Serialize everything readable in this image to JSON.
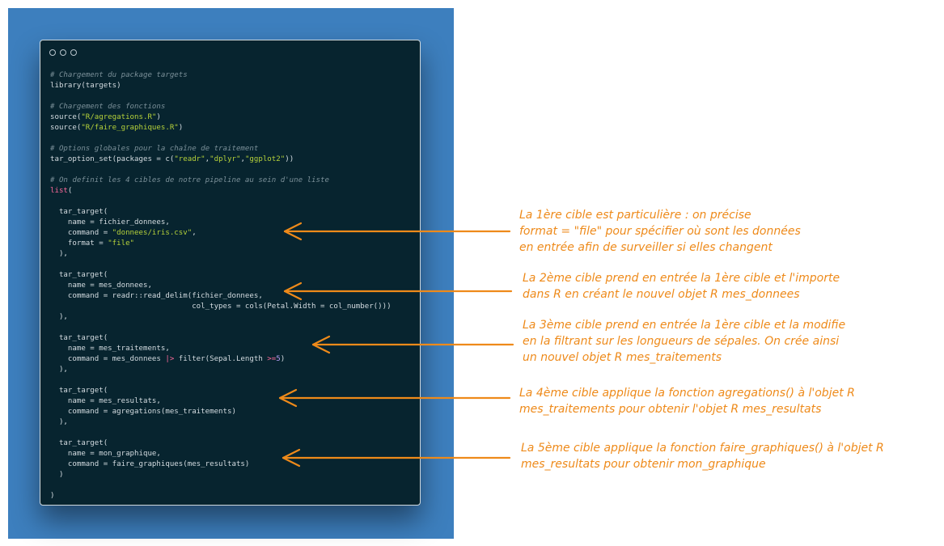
{
  "colors": {
    "background_panel": "#3d7fbe",
    "code_background": "#07242f",
    "annotation": "#ee8a1a",
    "comment": "#7b9099",
    "string": "#b5d13a",
    "keyword": "#ff6a9b",
    "number": "#b39df3"
  },
  "code": {
    "lines": [
      [
        {
          "t": "# Chargement du package targets",
          "c": "c"
        }
      ],
      [
        {
          "t": "library(targets)",
          "c": "p"
        }
      ],
      [],
      [
        {
          "t": "# Chargement des fonctions",
          "c": "c"
        }
      ],
      [
        {
          "t": "source(",
          "c": "p"
        },
        {
          "t": "\"R/agregations.R\"",
          "c": "s"
        },
        {
          "t": ")",
          "c": "p"
        }
      ],
      [
        {
          "t": "source(",
          "c": "p"
        },
        {
          "t": "\"R/faire_graphiques.R\"",
          "c": "s"
        },
        {
          "t": ")",
          "c": "p"
        }
      ],
      [],
      [
        {
          "t": "# Options globales pour la chaîne de traitement",
          "c": "c"
        }
      ],
      [
        {
          "t": "tar_option_set(packages = c(",
          "c": "p"
        },
        {
          "t": "\"readr\"",
          "c": "s"
        },
        {
          "t": ",",
          "c": "p"
        },
        {
          "t": "\"dplyr\"",
          "c": "s"
        },
        {
          "t": ",",
          "c": "p"
        },
        {
          "t": "\"ggplot2\"",
          "c": "s"
        },
        {
          "t": "))",
          "c": "p"
        }
      ],
      [],
      [
        {
          "t": "# On definit les 4 cibles de notre pipeline au sein d'une liste",
          "c": "c"
        }
      ],
      [
        {
          "t": "list",
          "c": "k"
        },
        {
          "t": "(",
          "c": "p"
        }
      ],
      [],
      [
        {
          "t": "  tar_target(",
          "c": "p"
        }
      ],
      [
        {
          "t": "    name = fichier_donnees,",
          "c": "p"
        }
      ],
      [
        {
          "t": "    command = ",
          "c": "p"
        },
        {
          "t": "\"donnees/iris.csv\"",
          "c": "s"
        },
        {
          "t": ",",
          "c": "p"
        }
      ],
      [
        {
          "t": "    format = ",
          "c": "p"
        },
        {
          "t": "\"file\"",
          "c": "s"
        }
      ],
      [
        {
          "t": "  ),",
          "c": "p"
        }
      ],
      [],
      [
        {
          "t": "  tar_target(",
          "c": "p"
        }
      ],
      [
        {
          "t": "    name = mes_donnees,",
          "c": "p"
        }
      ],
      [
        {
          "t": "    command = readr::read_delim(fichier_donnees,",
          "c": "p"
        }
      ],
      [
        {
          "t": "                                col_types = cols(Petal.Width = col_number()))",
          "c": "p"
        }
      ],
      [
        {
          "t": "  ),",
          "c": "p"
        }
      ],
      [],
      [
        {
          "t": "  tar_target(",
          "c": "p"
        }
      ],
      [
        {
          "t": "    name = mes_traitements,",
          "c": "p"
        }
      ],
      [
        {
          "t": "    command = mes_donnees ",
          "c": "p"
        },
        {
          "t": "|>",
          "c": "k"
        },
        {
          "t": " filter(Sepal.Length ",
          "c": "p"
        },
        {
          "t": ">=",
          "c": "k"
        },
        {
          "t": "5",
          "c": "n"
        },
        {
          "t": ")",
          "c": "p"
        }
      ],
      [
        {
          "t": "  ),",
          "c": "p"
        }
      ],
      [],
      [
        {
          "t": "  tar_target(",
          "c": "p"
        }
      ],
      [
        {
          "t": "    name = mes_resultats,",
          "c": "p"
        }
      ],
      [
        {
          "t": "    command = agregations(mes_traitements)",
          "c": "p"
        }
      ],
      [
        {
          "t": "  ),",
          "c": "p"
        }
      ],
      [],
      [
        {
          "t": "  tar_target(",
          "c": "p"
        }
      ],
      [
        {
          "t": "    name = mon_graphique,",
          "c": "p"
        }
      ],
      [
        {
          "t": "    command = faire_graphiques(mes_resultats)",
          "c": "p"
        }
      ],
      [
        {
          "t": "  )",
          "c": "p"
        }
      ],
      [],
      [
        {
          "t": ")",
          "c": "p"
        }
      ]
    ]
  },
  "annotations": [
    {
      "text": "La 1ère cible est particulière : on précise\nformat = \"file\" pour spécifier où sont les données\nen entrée afin de surveiller si elles changent"
    },
    {
      "text": "La 2ème cible prend en entrée la 1ère cible et l'importe\ndans R en créant le nouvel objet R mes_donnees"
    },
    {
      "text": "La 3ème cible prend en entrée la 1ère cible et la modifie\nen la filtrant sur les longueurs de sépales. On crée ainsi\nun nouvel objet R mes_traitements"
    },
    {
      "text": "La 4ème cible applique la fonction agregations() à l'objet R\nmes_traitements pour obtenir l'objet R mes_resultats"
    },
    {
      "text": "La 5ème cible applique la fonction faire_graphiques() à l'objet R\nmes_resultats pour obtenir mon_graphique"
    }
  ]
}
